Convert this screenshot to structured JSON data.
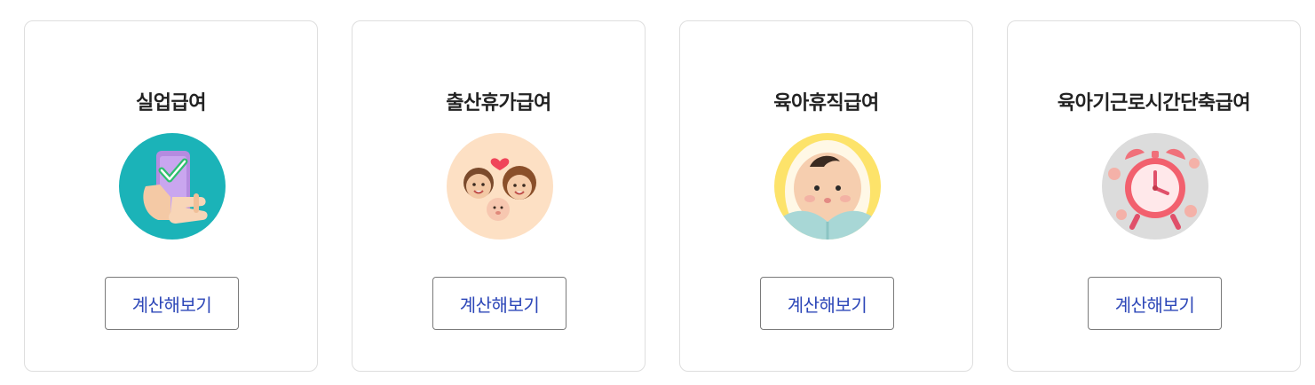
{
  "cards": [
    {
      "title": "실업급여",
      "icon": "phone-checkmark-icon",
      "button_label": "계산해보기",
      "icon_bg": "#1bb3b8"
    },
    {
      "title": "출산휴가급여",
      "icon": "family-icon",
      "button_label": "계산해보기",
      "icon_bg": "#fde0c4"
    },
    {
      "title": "육아휴직급여",
      "icon": "baby-icon",
      "button_label": "계산해보기",
      "icon_bg": "#fde36a"
    },
    {
      "title": "육아기근로시간단축급여",
      "icon": "alarm-clock-icon",
      "button_label": "계산해보기",
      "icon_bg": "#dcdcdc"
    }
  ],
  "colors": {
    "button_text": "#2d47b8",
    "title_text": "#222222",
    "card_border": "#dedede"
  }
}
